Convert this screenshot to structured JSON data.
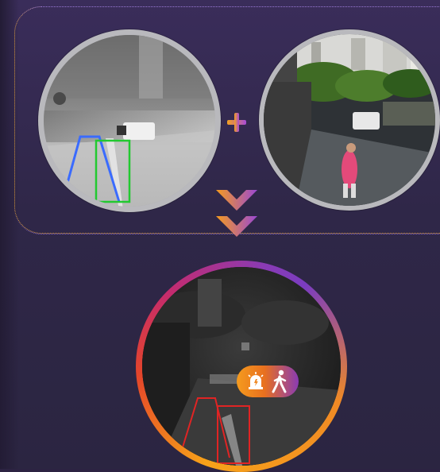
{
  "scene": {
    "thermal_input": {
      "label": "",
      "box_colors": [
        "#3a6bff",
        "#22c930"
      ]
    },
    "visible_input": {
      "label": ""
    },
    "result": {
      "box_color": "#e02424"
    }
  },
  "icons": {
    "combine": "plus-icon",
    "flow": "double-chevron-down-icon",
    "alarm": "siren-icon",
    "person": "walking-person-icon"
  },
  "colors": {
    "background": "#2c2342",
    "accent_orange": "#f59b1e",
    "accent_purple": "#8a3bb4"
  }
}
